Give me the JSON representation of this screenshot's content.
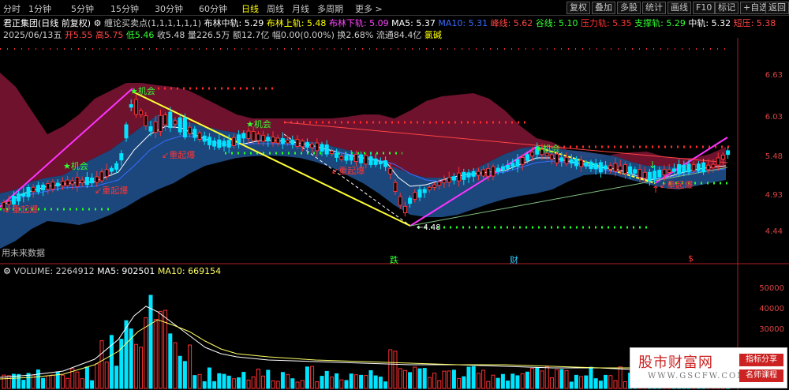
{
  "toolbar": {
    "periods": [
      "分时",
      "1分钟",
      "5分钟",
      "15分钟",
      "30分钟",
      "60分钟",
      "日线",
      "周线",
      "月线",
      "多周期",
      "更多 >"
    ],
    "active_period": "日线",
    "right_buttons": [
      "复权",
      "叠加",
      "多股",
      "统计",
      "画线",
      "F10",
      "标记",
      "+自选",
      "返回"
    ]
  },
  "info_line1": {
    "title": "君正集团(日线 前复权)",
    "indicator": "缠论买卖点(1,1,1,1,1,1)",
    "items": [
      {
        "label": "布林中轨: 5.29",
        "color": "#ffffff"
      },
      {
        "label": "布林上轨: 5.48",
        "color": "#ffff00"
      },
      {
        "label": "布林下轨: 5.09",
        "color": "#ff44ff"
      },
      {
        "label": "MA5: 5.37",
        "color": "#ffffff"
      },
      {
        "label": "MA10: 5.31",
        "color": "#3a6cff"
      },
      {
        "label": "峰线: 5.62",
        "color": "#ff4444"
      },
      {
        "label": "谷线: 5.10",
        "color": "#33ff33"
      },
      {
        "label": "压力轨: 5.35",
        "color": "#ff3333"
      },
      {
        "label": "支撑轨: 5.29",
        "color": "#33ff33"
      },
      {
        "label": "中轨: 5.32",
        "color": "#ffffff"
      },
      {
        "label": "短压: 5.38",
        "color": "#ff4444"
      }
    ]
  },
  "info_line2": {
    "date": "2025/06/13五",
    "items": [
      {
        "label": "开5.55",
        "color": "#ff4444"
      },
      {
        "label": "高5.75",
        "color": "#ff4444"
      },
      {
        "label": "低5.46",
        "color": "#33ff33"
      },
      {
        "label": "收5.48",
        "color": "#cccccc"
      },
      {
        "label": "量226.5万",
        "color": "#cccccc"
      },
      {
        "label": "额12.7亿",
        "color": "#cccccc"
      },
      {
        "label": "幅0.00(0.00%)",
        "color": "#cccccc"
      },
      {
        "label": "换2.68%",
        "color": "#cccccc"
      },
      {
        "label": "流通84.4亿",
        "color": "#cccccc"
      },
      {
        "label": "氯碱",
        "color": "#ffff00"
      }
    ]
  },
  "price_axis": [
    "6.63",
    "6.03",
    "5.48",
    "4.93",
    "4.44"
  ],
  "signals": {
    "chance": "机会",
    "reboom": "重起爆",
    "low_price": "4.48",
    "future": "用未来数据"
  },
  "event_marks": [
    "跌",
    "财",
    "$"
  ],
  "volume_info": {
    "label": "VOLUME: 2264912",
    "ma5": "MA5: 902501",
    "ma10": "MA10: 669154"
  },
  "volume_axis": [
    "50000",
    "40000",
    "30000"
  ],
  "watermark": {
    "title": "股市财富网",
    "url": "WWW.GSCFW.COM",
    "tag1": "指标分享",
    "tag2": "名师课程"
  },
  "colors": {
    "up": "#ff3333",
    "down": "#00e5ff",
    "chance": "#33ff33",
    "reboom": "#ff3333"
  }
}
